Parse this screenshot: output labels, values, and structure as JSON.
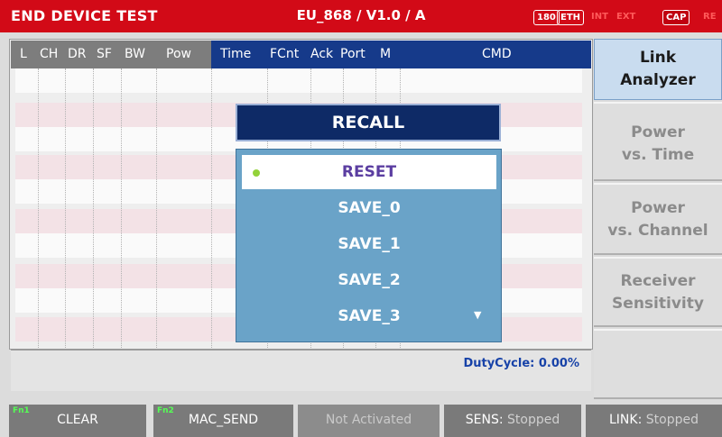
{
  "topbar": {
    "title": "END DEVICE TEST",
    "subtitle": "EU_868 / V1.0 / A",
    "badges": [
      "180",
      "ETH",
      "INT",
      "EXT",
      "CAP",
      "RE"
    ]
  },
  "table": {
    "left_headers": [
      "L",
      "CH",
      "DR",
      "SF",
      "BW",
      "Pow"
    ],
    "right_headers": [
      "Time",
      "FCnt",
      "Ack",
      "Port",
      "M",
      "CMD"
    ]
  },
  "status": {
    "duty_cycle": "DutyCycle: 0.00%"
  },
  "side_menu": [
    {
      "label1": "Link",
      "label2": "Analyzer",
      "active": true
    },
    {
      "label1": "Power",
      "label2": "vs. Time",
      "active": false
    },
    {
      "label1": "Power",
      "label2": "vs. Channel",
      "active": false
    },
    {
      "label1": "Receiver",
      "label2": "Sensitivity",
      "active": false
    }
  ],
  "function_keys": {
    "fn1": {
      "tag": "Fn1",
      "label": "CLEAR"
    },
    "fn2": {
      "tag": "Fn2",
      "label": "MAC_SEND"
    },
    "f3": {
      "label": "Not Activated"
    },
    "f4": {
      "label": "SENS:",
      "value": "Stopped"
    },
    "f5": {
      "label": "LINK:",
      "value": "Stopped"
    }
  },
  "recall": {
    "title": "RECALL",
    "items": [
      "RESET",
      "SAVE_0",
      "SAVE_1",
      "SAVE_2",
      "SAVE_3"
    ],
    "selected": "RESET",
    "scroll_icon": "down-arrow-icon"
  },
  "colors": {
    "topbar": "#d20a17",
    "header_grey": "#7d7d7d",
    "header_blue": "#163a8a",
    "stripe": "#f3e2e6",
    "dialog_title": "#0e2a66",
    "dialog_list": "#6aa3c8",
    "selected_text": "#5b3ea1",
    "selected_dot": "#93d23a"
  }
}
